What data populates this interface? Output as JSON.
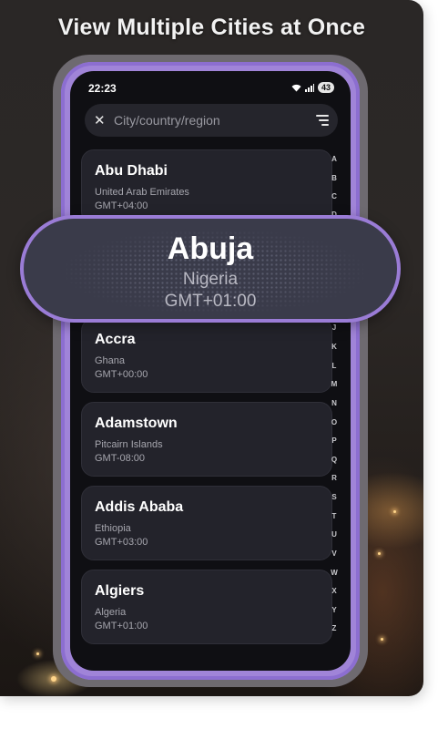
{
  "headline": "View Multiple Cities at Once",
  "status_bar": {
    "time": "22:23",
    "battery": "43"
  },
  "search": {
    "placeholder": "City/country/region"
  },
  "cities": [
    {
      "name": "Abu Dhabi",
      "country": "United Arab Emirates",
      "gmt": "GMT+04:00"
    },
    {
      "name": "Accra",
      "country": "Ghana",
      "gmt": "GMT+00:00"
    },
    {
      "name": "Adamstown",
      "country": "Pitcairn Islands",
      "gmt": "GMT-08:00"
    },
    {
      "name": "Addis Ababa",
      "country": "Ethiopia",
      "gmt": "GMT+03:00"
    },
    {
      "name": "Algiers",
      "country": "Algeria",
      "gmt": "GMT+01:00"
    }
  ],
  "alphabet_index": [
    "A",
    "B",
    "C",
    "D",
    "J",
    "K",
    "L",
    "M",
    "N",
    "O",
    "P",
    "Q",
    "R",
    "S",
    "T",
    "U",
    "V",
    "W",
    "X",
    "Y",
    "Z"
  ],
  "highlight": {
    "city": "Abuja",
    "country": "Nigeria",
    "gmt": "GMT+01:00"
  },
  "colors": {
    "accent_border": "#9a7cd6",
    "card_background": "#23232b",
    "screen_background": "#0f0f13"
  }
}
